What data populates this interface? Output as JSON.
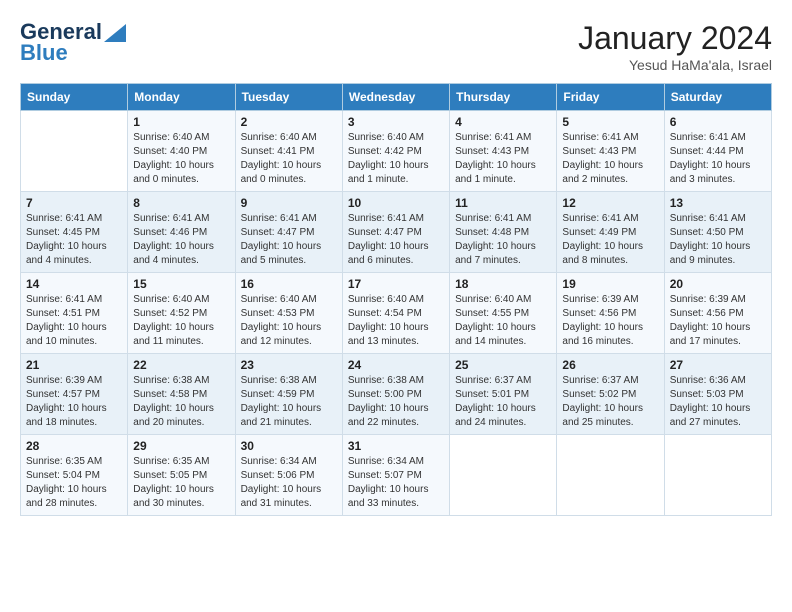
{
  "header": {
    "logo_line1": "General",
    "logo_line2": "Blue",
    "month_title": "January 2024",
    "location": "Yesud HaMa'ala, Israel"
  },
  "weekdays": [
    "Sunday",
    "Monday",
    "Tuesday",
    "Wednesday",
    "Thursday",
    "Friday",
    "Saturday"
  ],
  "weeks": [
    [
      {
        "day": "",
        "info": ""
      },
      {
        "day": "1",
        "info": "Sunrise: 6:40 AM\nSunset: 4:40 PM\nDaylight: 10 hours\nand 0 minutes."
      },
      {
        "day": "2",
        "info": "Sunrise: 6:40 AM\nSunset: 4:41 PM\nDaylight: 10 hours\nand 0 minutes."
      },
      {
        "day": "3",
        "info": "Sunrise: 6:40 AM\nSunset: 4:42 PM\nDaylight: 10 hours\nand 1 minute."
      },
      {
        "day": "4",
        "info": "Sunrise: 6:41 AM\nSunset: 4:43 PM\nDaylight: 10 hours\nand 1 minute."
      },
      {
        "day": "5",
        "info": "Sunrise: 6:41 AM\nSunset: 4:43 PM\nDaylight: 10 hours\nand 2 minutes."
      },
      {
        "day": "6",
        "info": "Sunrise: 6:41 AM\nSunset: 4:44 PM\nDaylight: 10 hours\nand 3 minutes."
      }
    ],
    [
      {
        "day": "7",
        "info": "Sunrise: 6:41 AM\nSunset: 4:45 PM\nDaylight: 10 hours\nand 4 minutes."
      },
      {
        "day": "8",
        "info": "Sunrise: 6:41 AM\nSunset: 4:46 PM\nDaylight: 10 hours\nand 4 minutes."
      },
      {
        "day": "9",
        "info": "Sunrise: 6:41 AM\nSunset: 4:47 PM\nDaylight: 10 hours\nand 5 minutes."
      },
      {
        "day": "10",
        "info": "Sunrise: 6:41 AM\nSunset: 4:47 PM\nDaylight: 10 hours\nand 6 minutes."
      },
      {
        "day": "11",
        "info": "Sunrise: 6:41 AM\nSunset: 4:48 PM\nDaylight: 10 hours\nand 7 minutes."
      },
      {
        "day": "12",
        "info": "Sunrise: 6:41 AM\nSunset: 4:49 PM\nDaylight: 10 hours\nand 8 minutes."
      },
      {
        "day": "13",
        "info": "Sunrise: 6:41 AM\nSunset: 4:50 PM\nDaylight: 10 hours\nand 9 minutes."
      }
    ],
    [
      {
        "day": "14",
        "info": "Sunrise: 6:41 AM\nSunset: 4:51 PM\nDaylight: 10 hours\nand 10 minutes."
      },
      {
        "day": "15",
        "info": "Sunrise: 6:40 AM\nSunset: 4:52 PM\nDaylight: 10 hours\nand 11 minutes."
      },
      {
        "day": "16",
        "info": "Sunrise: 6:40 AM\nSunset: 4:53 PM\nDaylight: 10 hours\nand 12 minutes."
      },
      {
        "day": "17",
        "info": "Sunrise: 6:40 AM\nSunset: 4:54 PM\nDaylight: 10 hours\nand 13 minutes."
      },
      {
        "day": "18",
        "info": "Sunrise: 6:40 AM\nSunset: 4:55 PM\nDaylight: 10 hours\nand 14 minutes."
      },
      {
        "day": "19",
        "info": "Sunrise: 6:39 AM\nSunset: 4:56 PM\nDaylight: 10 hours\nand 16 minutes."
      },
      {
        "day": "20",
        "info": "Sunrise: 6:39 AM\nSunset: 4:56 PM\nDaylight: 10 hours\nand 17 minutes."
      }
    ],
    [
      {
        "day": "21",
        "info": "Sunrise: 6:39 AM\nSunset: 4:57 PM\nDaylight: 10 hours\nand 18 minutes."
      },
      {
        "day": "22",
        "info": "Sunrise: 6:38 AM\nSunset: 4:58 PM\nDaylight: 10 hours\nand 20 minutes."
      },
      {
        "day": "23",
        "info": "Sunrise: 6:38 AM\nSunset: 4:59 PM\nDaylight: 10 hours\nand 21 minutes."
      },
      {
        "day": "24",
        "info": "Sunrise: 6:38 AM\nSunset: 5:00 PM\nDaylight: 10 hours\nand 22 minutes."
      },
      {
        "day": "25",
        "info": "Sunrise: 6:37 AM\nSunset: 5:01 PM\nDaylight: 10 hours\nand 24 minutes."
      },
      {
        "day": "26",
        "info": "Sunrise: 6:37 AM\nSunset: 5:02 PM\nDaylight: 10 hours\nand 25 minutes."
      },
      {
        "day": "27",
        "info": "Sunrise: 6:36 AM\nSunset: 5:03 PM\nDaylight: 10 hours\nand 27 minutes."
      }
    ],
    [
      {
        "day": "28",
        "info": "Sunrise: 6:35 AM\nSunset: 5:04 PM\nDaylight: 10 hours\nand 28 minutes."
      },
      {
        "day": "29",
        "info": "Sunrise: 6:35 AM\nSunset: 5:05 PM\nDaylight: 10 hours\nand 30 minutes."
      },
      {
        "day": "30",
        "info": "Sunrise: 6:34 AM\nSunset: 5:06 PM\nDaylight: 10 hours\nand 31 minutes."
      },
      {
        "day": "31",
        "info": "Sunrise: 6:34 AM\nSunset: 5:07 PM\nDaylight: 10 hours\nand 33 minutes."
      },
      {
        "day": "",
        "info": ""
      },
      {
        "day": "",
        "info": ""
      },
      {
        "day": "",
        "info": ""
      }
    ]
  ]
}
